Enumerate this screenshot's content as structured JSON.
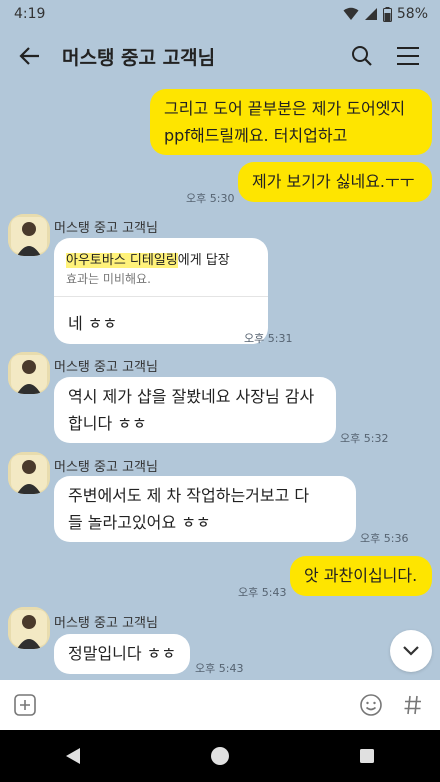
{
  "status_bar": {
    "time": "4:19",
    "battery": "58%"
  },
  "header": {
    "title": "머스탱 중고 고객님"
  },
  "messages": {
    "m1": {
      "line1": "그리고 도어 끝부분은 제가 도어엣지",
      "line2": "ppf해드릴께요. 터치업하고"
    },
    "m2": {
      "text": "제가 보기가 싫네요.ㅜㅜ",
      "time": "오후 5:30"
    },
    "m3": {
      "sender": "머스탱 중고 고객님",
      "reply_to_name": "아우토바스 디테일링",
      "reply_to_suffix": "에게 답장",
      "reply_quote": "효과는 미비해요.",
      "text": "네 ㅎㅎ",
      "time": "오후 5:31"
    },
    "m4": {
      "sender": "머스탱 중고 고객님",
      "line1": "역시 제가 샵을 잘봤네요 사장님 감사",
      "line2": "합니다 ㅎㅎ",
      "time": "오후 5:32"
    },
    "m5": {
      "sender": "머스탱 중고 고객님",
      "line1": "주변에서도 제 차 작업하는거보고 다",
      "line2": "들 놀라고있어요 ㅎㅎ",
      "time": "오후 5:36"
    },
    "m6": {
      "text": "앗 과찬이십니다.",
      "time": "오후 5:43"
    },
    "m7": {
      "sender": "머스탱 중고 고객님",
      "text": "정말입니다 ㅎㅎ",
      "time": "오후 5:43"
    }
  },
  "input": {
    "placeholder": ""
  },
  "icons": {
    "back": "arrow-left",
    "search": "magnifier",
    "menu": "hamburger",
    "attach": "plus-box",
    "emoji": "smiley",
    "hash": "hash",
    "scroll_down": "chevron-down",
    "nav_back": "triangle",
    "nav_home": "circle",
    "nav_recents": "square"
  },
  "colors": {
    "background": "#b2c7d9",
    "my_bubble": "#fee500",
    "their_bubble": "#ffffff",
    "reply_highlight": "#fff27a"
  }
}
